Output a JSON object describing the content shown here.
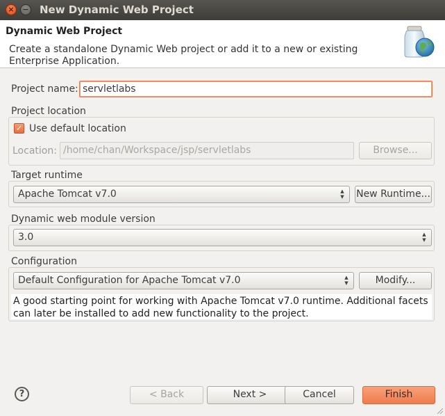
{
  "window": {
    "title": "New Dynamic Web Project",
    "close_glyph": "×",
    "minimize_glyph": "−"
  },
  "banner": {
    "title": "Dynamic Web Project",
    "description": "Create a standalone Dynamic Web project or add it to a new or existing Enterprise Application.",
    "icon": "web-project-jar-globe-icon"
  },
  "project_name": {
    "label": "Project name:",
    "value": "servletlabs"
  },
  "project_location": {
    "group_label": "Project location",
    "use_default_label": "Use default location",
    "use_default_checked": true,
    "location_label": "Location:",
    "location_value": "/home/chan/Workspace/jsp/servletlabs",
    "browse_label": "Browse..."
  },
  "target_runtime": {
    "group_label": "Target runtime",
    "selected": "Apache Tomcat v7.0",
    "new_runtime_label": "New Runtime..."
  },
  "module_version": {
    "group_label": "Dynamic web module version",
    "selected": "3.0"
  },
  "configuration": {
    "group_label": "Configuration",
    "selected": "Default Configuration for Apache Tomcat v7.0",
    "modify_label": "Modify...",
    "description": "A good starting point for working with Apache Tomcat v7.0 runtime. Additional facets can later be installed to add new functionality to the project."
  },
  "footer": {
    "help_glyph": "?",
    "back_label": "< Back",
    "next_label": "Next >",
    "cancel_label": "Cancel",
    "finish_label": "Finish"
  },
  "colors": {
    "accent": "#ef7c4e",
    "focus_border": "#e97b4a",
    "titlebar": "#3d3c37"
  }
}
